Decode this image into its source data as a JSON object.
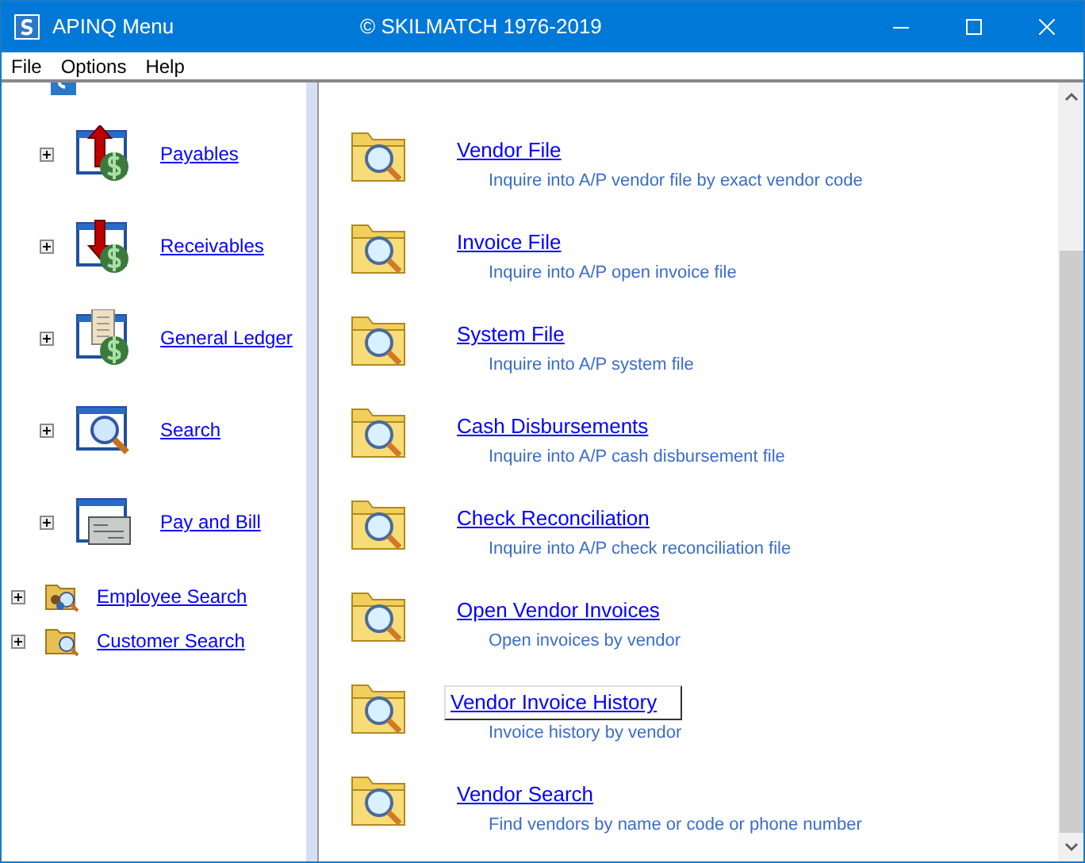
{
  "window": {
    "title": "APINQ Menu",
    "subtitle": "© SKILMATCH 1976-2019"
  },
  "menu": [
    {
      "label": "File"
    },
    {
      "label": "Options"
    },
    {
      "label": "Help"
    }
  ],
  "sidebar": {
    "items": [
      {
        "kind": "module",
        "children": [
          {
            "kind": "module",
            "label": "Payables",
            "expanded": false
          },
          {
            "kind": "module",
            "label": "Receivables",
            "expanded": false
          },
          {
            "kind": "module",
            "label": "General Ledger",
            "expanded": false
          },
          {
            "kind": "module",
            "label": "Search",
            "expanded": false
          },
          {
            "kind": "module",
            "label": "Pay and Bill",
            "expanded": false
          }
        ]
      },
      {
        "kind": "folder",
        "label": "Employee Search",
        "expanded": false
      },
      {
        "kind": "folder",
        "label": "Customer Search",
        "expanded": false
      }
    ]
  },
  "content": {
    "items": [
      {
        "title": "Vendor File",
        "description": "Inquire into A/P vendor file by exact vendor code",
        "selected": false
      },
      {
        "title": "Invoice File",
        "description": "Inquire into A/P open invoice file",
        "selected": false
      },
      {
        "title": "System File",
        "description": "Inquire into A/P system file",
        "selected": false
      },
      {
        "title": "Cash Disbursements",
        "description": "Inquire into A/P cash disbursement file",
        "selected": false
      },
      {
        "title": "Check Reconciliation",
        "description": "Inquire into A/P check reconciliation file",
        "selected": false
      },
      {
        "title": "Open Vendor Invoices",
        "description": "Open invoices by vendor",
        "selected": false
      },
      {
        "title": "Vendor Invoice History",
        "description": "Invoice history by vendor",
        "selected": true
      },
      {
        "title": "Vendor Search",
        "description": "Find vendors by name or code or phone number",
        "selected": false
      }
    ]
  }
}
